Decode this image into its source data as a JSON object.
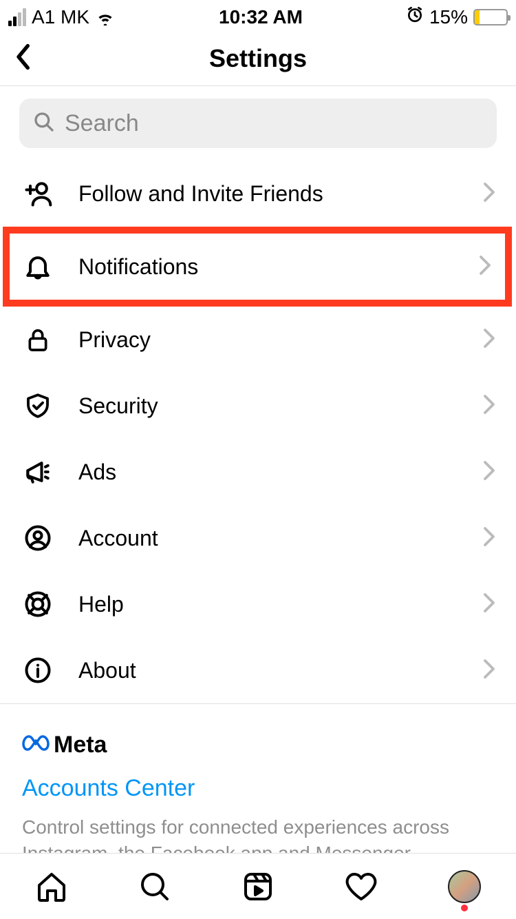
{
  "status": {
    "carrier": "A1 MK",
    "time": "10:32 AM",
    "battery_pct": "15%"
  },
  "nav": {
    "title": "Settings"
  },
  "search": {
    "placeholder": "Search"
  },
  "items": [
    {
      "label": "Follow and Invite Friends",
      "icon": "add-person-icon"
    },
    {
      "label": "Notifications",
      "icon": "bell-icon"
    },
    {
      "label": "Privacy",
      "icon": "lock-icon"
    },
    {
      "label": "Security",
      "icon": "shield-icon"
    },
    {
      "label": "Ads",
      "icon": "megaphone-icon"
    },
    {
      "label": "Account",
      "icon": "person-circle-icon"
    },
    {
      "label": "Help",
      "icon": "lifebuoy-icon"
    },
    {
      "label": "About",
      "icon": "info-icon"
    }
  ],
  "meta": {
    "brand": "Meta",
    "link": "Accounts Center",
    "desc": "Control settings for connected experiences across Instagram, the Facebook app and Messenger, including story and post sharing and logging in."
  }
}
